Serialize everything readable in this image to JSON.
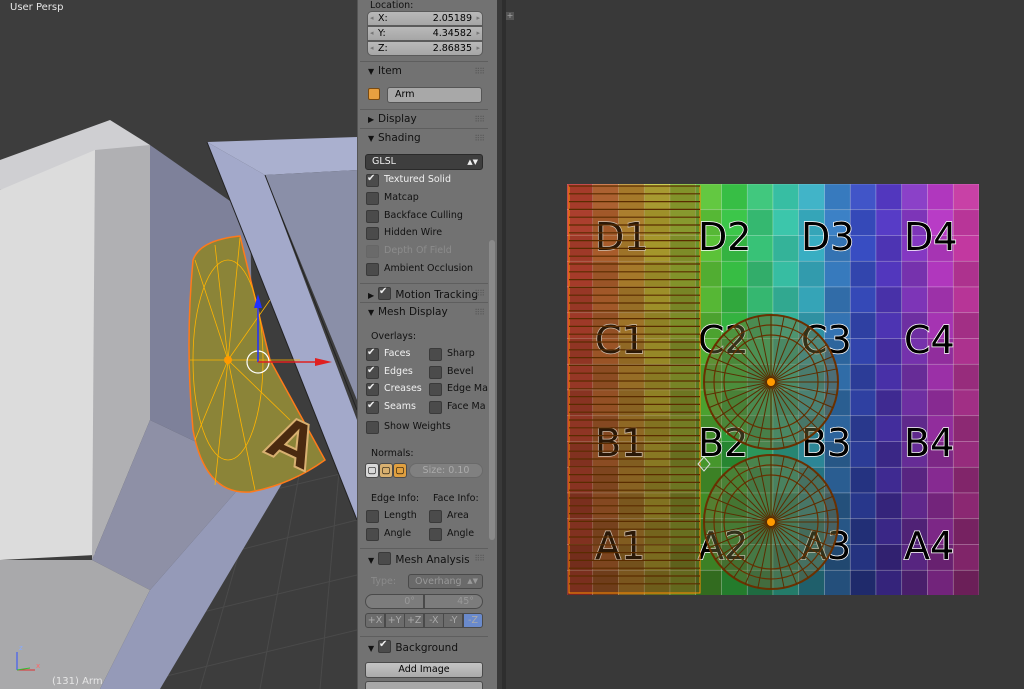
{
  "viewport": {
    "view_label": "User Persp",
    "object_info": "(131) Arm",
    "axis_labels": {
      "z": "z",
      "x": "x"
    }
  },
  "panel": {
    "location": {
      "title": "Location:",
      "x": {
        "label": "X:",
        "value": "2.05189"
      },
      "y": {
        "label": "Y:",
        "value": "4.34582"
      },
      "z": {
        "label": "Z:",
        "value": "2.86835"
      }
    },
    "item": {
      "title": "Item",
      "name": "Arm",
      "icon": "object-cube-icon"
    },
    "display": {
      "title": "Display"
    },
    "shading": {
      "title": "Shading",
      "mode": "GLSL",
      "options": [
        {
          "label": "Textured Solid",
          "checked": true,
          "enabled": true
        },
        {
          "label": "Matcap",
          "checked": false,
          "enabled": true
        },
        {
          "label": "Backface Culling",
          "checked": false,
          "enabled": true
        },
        {
          "label": "Hidden Wire",
          "checked": false,
          "enabled": true
        },
        {
          "label": "Depth Of Field",
          "checked": false,
          "enabled": false
        },
        {
          "label": "Ambient Occlusion",
          "checked": false,
          "enabled": true
        }
      ]
    },
    "motion_tracking": {
      "title": "Motion Tracking",
      "checked": true
    },
    "mesh_display": {
      "title": "Mesh Display",
      "overlays_label": "Overlays:",
      "overlays_left": [
        {
          "label": "Faces",
          "checked": true
        },
        {
          "label": "Edges",
          "checked": true
        },
        {
          "label": "Creases",
          "checked": true
        },
        {
          "label": "Seams",
          "checked": true
        }
      ],
      "overlays_right": [
        {
          "label": "Sharp",
          "checked": false
        },
        {
          "label": "Bevel",
          "checked": false
        },
        {
          "label": "Edge Ma",
          "checked": false
        },
        {
          "label": "Face Ma",
          "checked": false
        }
      ],
      "show_weights": "Show Weights",
      "normals_label": "Normals:",
      "normals_size": {
        "label": "Size:",
        "value": "0.10"
      },
      "edge_info_label": "Edge Info:",
      "face_info_label": "Face Info:",
      "edge_info": [
        "Length",
        "Angle"
      ],
      "face_info": [
        "Area",
        "Angle"
      ]
    },
    "mesh_analysis": {
      "title": "Mesh Analysis",
      "checked": false,
      "type_label": "Type:",
      "type_value": "Overhang",
      "min": "0°",
      "max": "45°",
      "axes": [
        "+X",
        "+Y",
        "+Z",
        "-X",
        "-Y",
        "-Z"
      ],
      "active_axis": "-Z"
    },
    "background_images": {
      "title": "Background Images",
      "checked": true,
      "add_button": "Add Image"
    }
  },
  "uv_editor": {
    "grid_labels": [
      [
        "D1",
        "D2",
        "D3",
        "D4"
      ],
      [
        "C1",
        "C2",
        "C3",
        "C4"
      ],
      [
        "B1",
        "B2",
        "B3",
        "B4"
      ],
      [
        "A1",
        "A2",
        "A3",
        "A4"
      ]
    ],
    "selection_color": "#ff8c00"
  }
}
